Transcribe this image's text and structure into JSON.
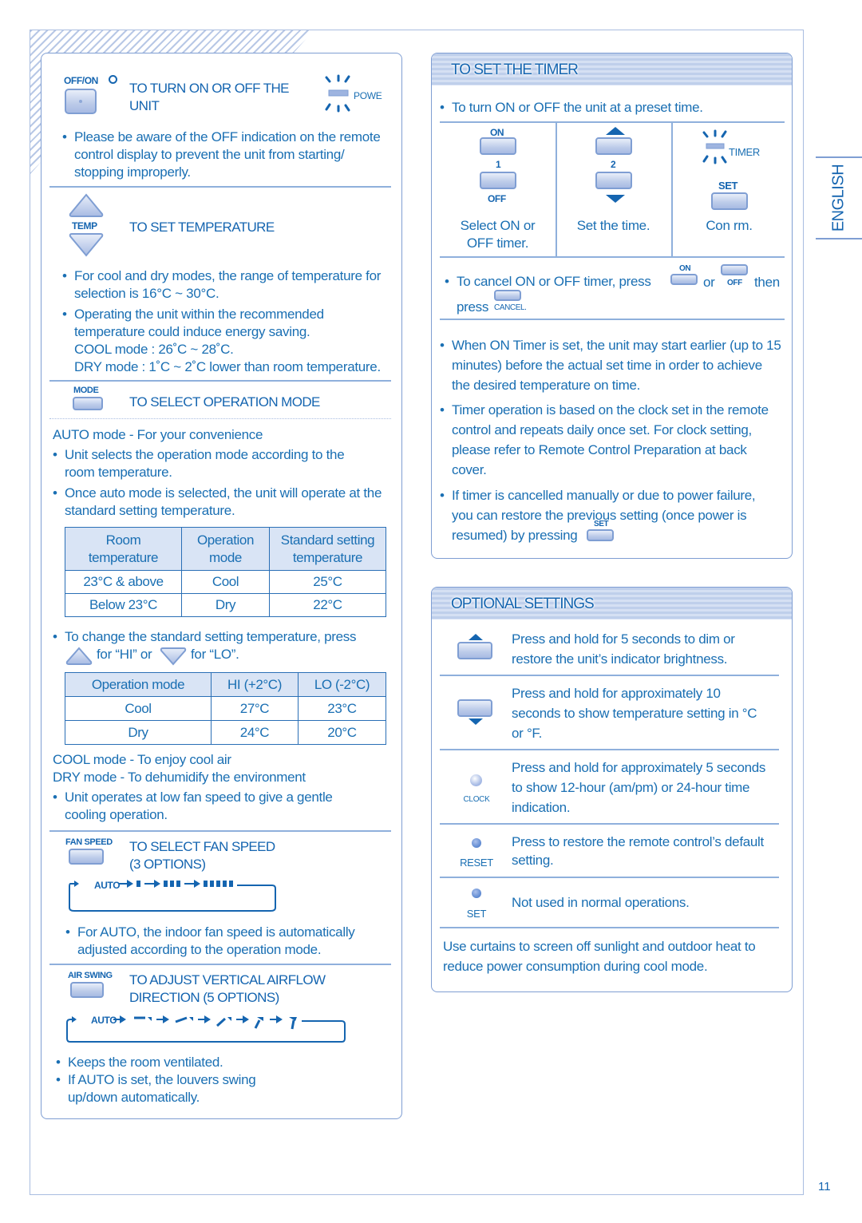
{
  "page": {
    "side_tab": "ENGLISH",
    "page_number": "11",
    "accent_color": "#1a6fb3"
  },
  "left": {
    "power": {
      "button_label": "OFF/ON",
      "heading_line1": "TO TURN ON OR OFF THE",
      "heading_line2": "UNIT",
      "indicator_label": "POWE",
      "bullets": [
        "Please be aware of the OFF indication on the remote control display to prevent the unit from starting/ stopping improperly."
      ]
    },
    "temp": {
      "button_label": "TEMP",
      "heading": "TO SET TEMPERATURE",
      "bullet1": "For cool and dry modes, the range of temperature for selection is 16°C ~ 30°C.",
      "bullet2_lines": [
        "Operating the unit within the recommended",
        "temperature could induce energy saving.",
        "COOL mode : 26˚C ~ 28˚C.",
        "DRY mode : 1˚C ~ 2˚C lower than room temperature."
      ]
    },
    "mode": {
      "button_label": "MODE",
      "heading": "TO SELECT OPERATION MODE",
      "auto_title": "AUTO mode - For your convenience",
      "auto_bullet1": "Unit selects the operation mode according to the room temperature.",
      "auto_bullet2": "Once auto mode is selected, the unit will operate at the standard setting temperature.",
      "table1": {
        "headers": [
          [
            "Room",
            "temperature"
          ],
          [
            "Operation",
            "mode"
          ],
          [
            "Standard setting",
            "temperature"
          ]
        ],
        "rows": [
          [
            "23°C & above",
            "Cool",
            "25°C"
          ],
          [
            "Below 23°C",
            "Dry",
            "22°C"
          ]
        ]
      },
      "change_line1": "To change the standard setting temperature, press",
      "change_hi": "for “HI” or",
      "change_lo": "for “LO”.",
      "table2": {
        "headers": [
          "Operation mode",
          "HI (+2°C)",
          "LO (-2°C)"
        ],
        "rows": [
          [
            "Cool",
            "27°C",
            "23°C"
          ],
          [
            "Dry",
            "24°C",
            "20°C"
          ]
        ]
      },
      "cool_title": "COOL mode - To enjoy cool air",
      "dry_title": "DRY mode - To dehumidify the environment",
      "dry_bullet": "Unit operates at low fan speed to give a gentle cooling operation."
    },
    "fan": {
      "button_label": "FAN SPEED",
      "heading_line1": "TO SELECT FAN SPEED",
      "heading_line2": "(3 OPTIONS)",
      "cycle_auto": "AUTO",
      "bullet": "For AUTO, the indoor fan speed is automatically adjusted according to the operation mode."
    },
    "swing": {
      "button_label": "AIR SWING",
      "heading_line1": "TO ADJUST VERTICAL AIRFLOW",
      "heading_line2": "DIRECTION  (5 OPTIONS)",
      "cycle_auto": "AUTO",
      "bullet1": "Keeps the room ventilated.",
      "bullet2": "If AUTO is set, the louvers swing up/down automatically."
    }
  },
  "timer": {
    "title": "TO SET THE TIMER",
    "intro": "To turn ON or OFF the unit at a preset time.",
    "steps": [
      {
        "top_label": "ON",
        "step_num": "1",
        "bottom_label": "OFF",
        "caption": "Select ON or OFF timer."
      },
      {
        "step_num": "2",
        "caption": "Set the time."
      },
      {
        "indicator_label": "TIMER",
        "button_label": "SET",
        "caption": "Con  rm."
      }
    ],
    "cancel_text_a": "To cancel ON or OFF  timer, press",
    "cancel_on": "ON",
    "cancel_or": "or",
    "cancel_off": "OFF",
    "cancel_then": "then",
    "cancel_press": "press",
    "cancel_label": "CANCEL.",
    "bullet_on_timer": "When ON Timer is set, the unit may start earlier (up to 15 minutes) before the actual set time in order to achieve the desired temperature on time.",
    "bullet_clock": "Timer operation is based on the clock set in the remote control and repeats daily once set. For clock setting, please refer to Remote Control Preparation at back cover.",
    "bullet_restore": "If timer is cancelled manually or due to power failure, you can restore the previous setting (once power is resumed) by pressing",
    "restore_btn_label": "SET"
  },
  "optional": {
    "title": "OPTIONAL SETTINGS",
    "items": [
      {
        "text": "Press and hold for 5 seconds to dim or restore the unit’s indicator brightness."
      },
      {
        "text": "Press and hold for approximately 10 seconds to show temperature setting in °C or °F."
      },
      {
        "label": "CLOCK",
        "text": "Press and hold for approximately 5 seconds to show 12-hour (am/pm) or 24-hour time indication."
      },
      {
        "label": "RESET",
        "text": "Press to restore the remote control’s default setting."
      },
      {
        "label": "SET",
        "text": "Not used in normal operations."
      }
    ],
    "footer": "Use curtains to screen off sunlight and outdoor heat to reduce power consumption during cool mode."
  }
}
